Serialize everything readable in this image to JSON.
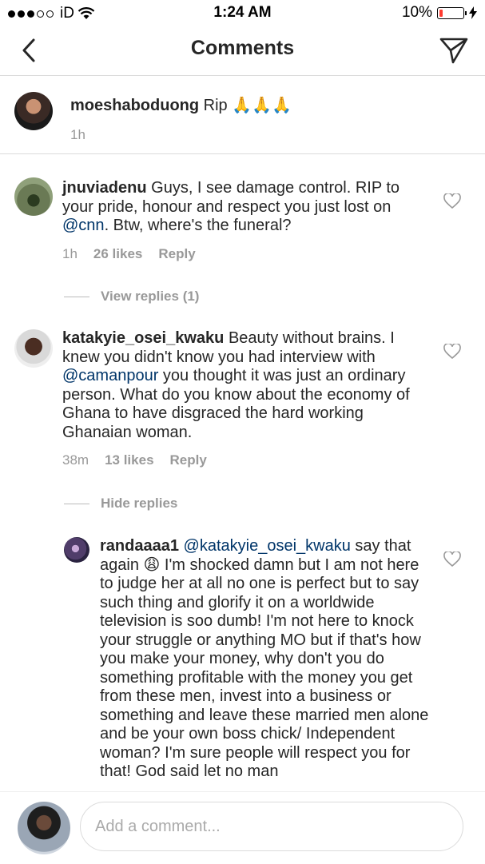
{
  "status_bar": {
    "carrier": "iD",
    "time": "1:24 AM",
    "battery": "10%"
  },
  "nav": {
    "title": "Comments",
    "back_icon": "chevron-left-icon",
    "send_icon": "paper-plane-icon"
  },
  "caption": {
    "username": "moeshaboduong",
    "text": "Rip 🙏🙏🙏",
    "time": "1h"
  },
  "comments": [
    {
      "username": "jnuviadenu",
      "text_before": "Guys, I see damage control. RIP to your pride, honour and respect you just lost on ",
      "mention": "@cnn",
      "text_after": ". Btw, where's the funeral?",
      "time": "1h",
      "likes": "26 likes",
      "reply": "Reply",
      "replies_toggle": "View replies (1)"
    },
    {
      "username": "katakyie_osei_kwaku",
      "text_before": "Beauty without brains. I knew you didn't know you had interview with ",
      "mention": "@camanpour",
      "text_after": " you thought it was just an ordinary person. What do you know about the economy of Ghana to have disgraced the hard working Ghanaian woman.",
      "time": "38m",
      "likes": "13 likes",
      "reply": "Reply",
      "replies_toggle": "Hide replies"
    }
  ],
  "reply": {
    "username": "randaaaa1",
    "mention": "@katakyie_osei_kwaku",
    "text_a": " say that again ",
    "emoji": "😩",
    "text_b": " I'm shocked damn but I am not here to judge her at all no one is perfect but to say such thing and glorify it on a worldwide television is soo dumb! I'm not here to knock your struggle or anything MO but if that's how you make your money, why don't you do something profitable with the money you get from these men, invest into a business or something and leave these married men alone and be your own boss chick/ Independent woman? I'm sure people will respect you for that! God said let no man"
  },
  "composer": {
    "placeholder": "Add a comment..."
  }
}
